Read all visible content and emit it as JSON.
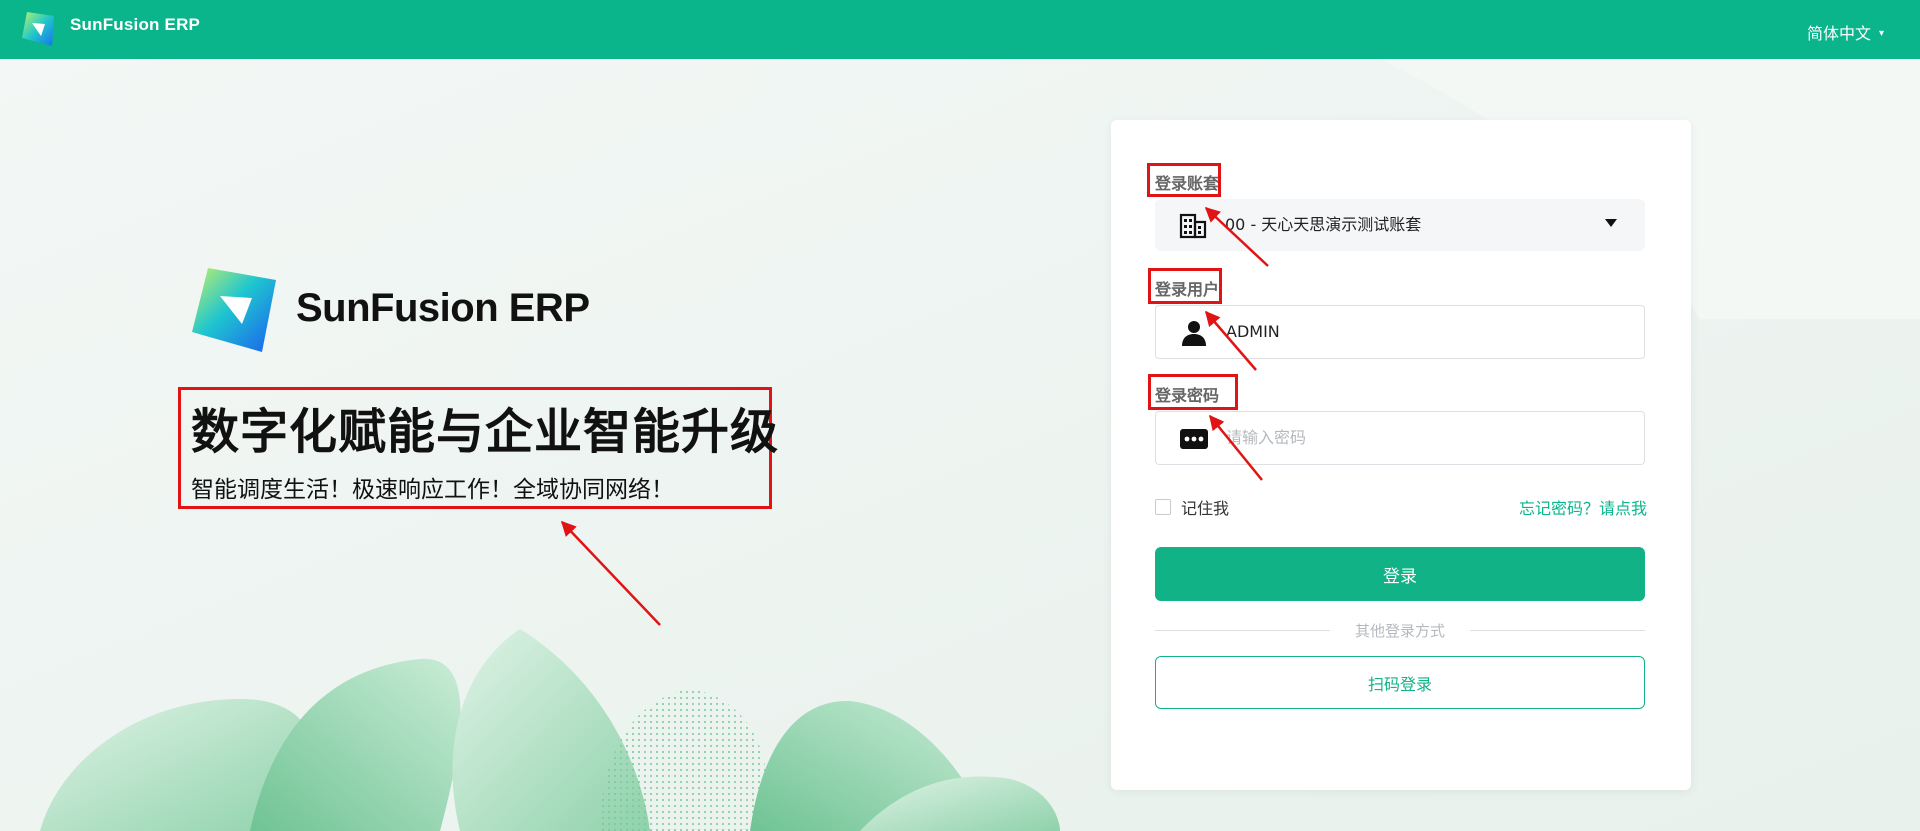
{
  "header": {
    "app_title": "SunFusion ERP",
    "language": "简体中文"
  },
  "hero": {
    "brand": "SunFusion ERP",
    "heading": "数字化赋能与企业智能升级",
    "subheading": "智能调度生活！极速响应工作！全域协同网络！"
  },
  "login": {
    "account_label": "登录账套",
    "account_value": "00 - 天心天思演示测试账套",
    "user_label": "登录用户",
    "user_value": "ADMIN",
    "password_label": "登录密码",
    "password_placeholder": "请输入密码",
    "remember_label": "记住我",
    "forgot_label": "忘记密码？请点我",
    "login_button": "登录",
    "other_methods": "其他登录方式",
    "qr_button": "扫码登录"
  },
  "colors": {
    "brand": "#0bb58b",
    "annotation": "#e01414"
  },
  "icons": {
    "account": "building-icon",
    "user": "user-icon",
    "password": "password-dots-icon",
    "language_caret": "caret-down-icon"
  }
}
